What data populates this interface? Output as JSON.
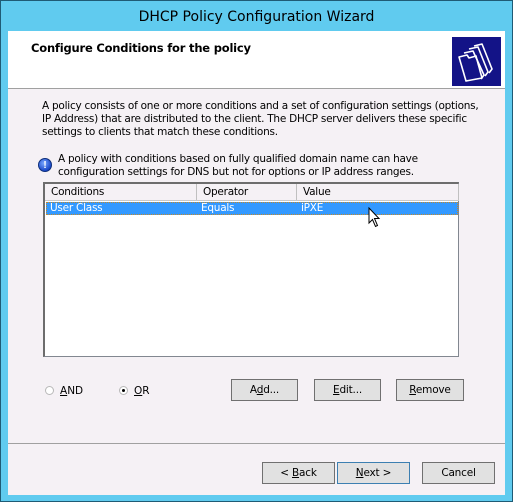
{
  "window": {
    "title": "DHCP Policy Configuration Wizard"
  },
  "header": {
    "title": "Configure Conditions for the policy",
    "icon": "folders-icon"
  },
  "description": "A policy consists of one or more conditions and a set of configuration settings (options, IP Address) that are distributed to the client. The DHCP server delivers these specific settings to clients that match these conditions.",
  "info": {
    "icon": "info-icon",
    "text": "A policy with conditions based on fully qualified domain name can have configuration settings for DNS but not for options or IP address ranges."
  },
  "conditions_table": {
    "columns": [
      "Conditions",
      "Operator",
      "Value"
    ],
    "rows": [
      {
        "condition": "User Class",
        "operator": "Equals",
        "value": "iPXE",
        "selected": true
      }
    ]
  },
  "logic": {
    "and_label": "AND",
    "or_label": "OR",
    "selected": "OR"
  },
  "actions": {
    "add": {
      "pre": "A",
      "mn": "d",
      "post": "d..."
    },
    "edit": {
      "pre": "",
      "mn": "E",
      "post": "dit..."
    },
    "remove": {
      "pre": "",
      "mn": "R",
      "post": "emove"
    }
  },
  "footer": {
    "back": {
      "pre": "< ",
      "mn": "B",
      "post": "ack"
    },
    "next": {
      "pre": "",
      "mn": "N",
      "post": "ext >"
    },
    "cancel": "Cancel"
  },
  "colors": {
    "frame": "#60cbef",
    "selection": "#3399ff",
    "header_icon_bg": "#0a0a78"
  }
}
